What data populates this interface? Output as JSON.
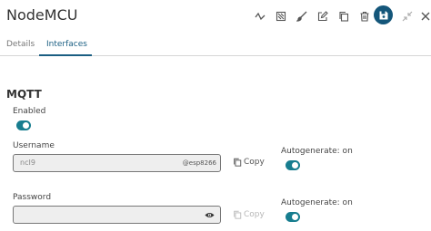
{
  "header": {
    "title": "NodeMCU",
    "icons": [
      "activity-icon",
      "filter-icon",
      "brush-icon",
      "edit-icon",
      "copy-icon",
      "delete-icon",
      "save-icon",
      "collapse-icon",
      "close-icon"
    ]
  },
  "tabs": [
    {
      "label": "Details",
      "active": false
    },
    {
      "label": "Interfaces",
      "active": true
    }
  ],
  "mqtt": {
    "title": "MQTT",
    "enabled_label": "Enabled",
    "enabled": true,
    "username": {
      "label": "Username",
      "value": "ncI9",
      "suffix": "@esp8266",
      "copy_label": "Copy",
      "autogenerate_label": "Autogenerate: on",
      "autogenerate": true
    },
    "password": {
      "label": "Password",
      "value": "",
      "copy_label": "Copy",
      "copy_disabled": true,
      "autogenerate_label": "Autogenerate: on",
      "autogenerate": true
    }
  },
  "colors": {
    "accent": "#1a5e82",
    "toggle_on": "#177d8f",
    "save_button": "#14567a"
  }
}
